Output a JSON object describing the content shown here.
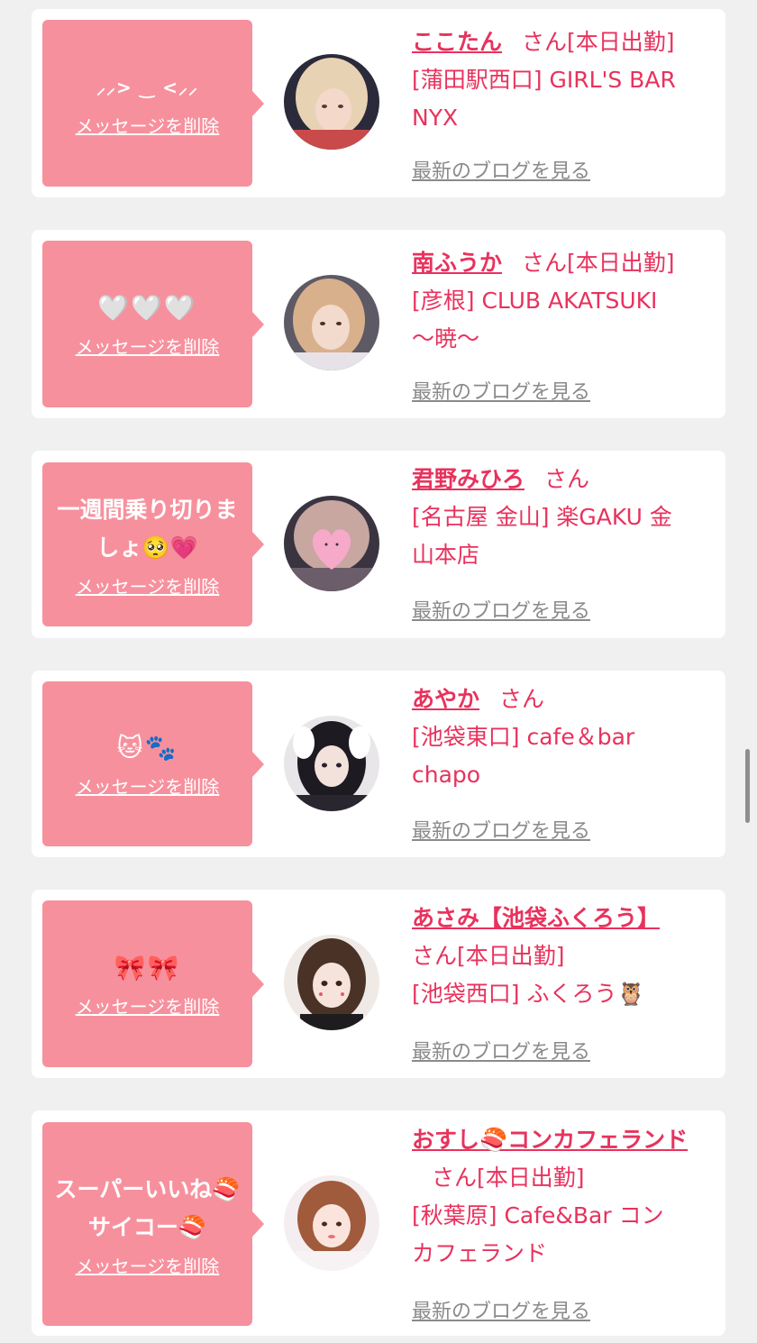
{
  "common": {
    "delete_label": "メッセージを削除",
    "blog_label": "最新のブログを見る",
    "san_label": "さん"
  },
  "items": [
    {
      "message": "⸝⸝> ‿ <⸝⸝",
      "name": "ここたん",
      "status": "[本日出勤]",
      "shop_line1": "[蒲田駅西口] GIRL'S BAR",
      "shop_line2": "NYX",
      "avatar_icon": "profile-photo"
    },
    {
      "message": "🤍🤍🤍",
      "name": "南ふうか",
      "status": "[本日出勤]",
      "shop_line1": "[彦根] CLUB AKATSUKI",
      "shop_line2": "〜暁〜",
      "avatar_icon": "profile-photo"
    },
    {
      "message": "一週間乗り切りましょ🥺💗",
      "name": "君野みひろ",
      "status": "",
      "shop_line1": "[名古屋 金山] 楽GAKU 金",
      "shop_line2": "山本店",
      "avatar_icon": "profile-photo-heart-sticker"
    },
    {
      "message": "🐱🐾",
      "name": "あやか",
      "status": "",
      "shop_line1": "[池袋東口] cafe＆bar",
      "shop_line2": "chapo",
      "avatar_icon": "profile-photo"
    },
    {
      "message": "🎀🎀",
      "name": "あさみ【池袋ふくろう】",
      "status": "[本日出勤]",
      "shop_line1": "[池袋西口] ふくろう🦉",
      "shop_line2": "",
      "avatar_icon": "profile-photo"
    },
    {
      "message": "スーパーいいね🍣サイコー🍣",
      "name": "おすし🍣コンカフェランド",
      "status": "[本日出勤]",
      "shop_line1": "[秋葉原] Cafe&Bar コン",
      "shop_line2": "カフェランド",
      "avatar_icon": "profile-photo"
    }
  ],
  "colors": {
    "page_bg": "#f0f0f0",
    "bubble_bg": "#f7909d",
    "accent": "#e8325d",
    "blog_link": "#8a8a8a"
  }
}
